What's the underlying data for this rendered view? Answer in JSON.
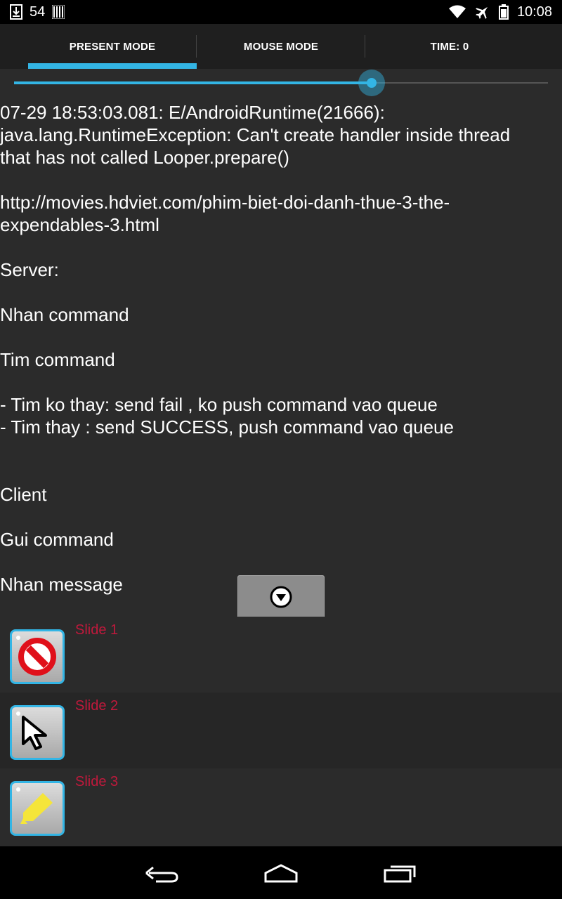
{
  "status_bar": {
    "notification_count": "54",
    "time": "10:08",
    "icons": [
      "download-icon",
      "barcode-icon",
      "wifi-icon",
      "airplane-mode-icon",
      "battery-icon"
    ]
  },
  "tabs": [
    {
      "label": "PRESENT MODE",
      "active": true
    },
    {
      "label": "MOUSE MODE",
      "active": false
    },
    {
      "label": "TIME: 0",
      "active": false
    }
  ],
  "slider": {
    "progress": 0.67
  },
  "notes": {
    "text": "07-29 18:53:03.081: E/AndroidRuntime(21666):\njava.lang.RuntimeException: Can't create handler inside thread\nthat has not called Looper.prepare()\n\nhttp://movies.hdviet.com/phim-biet-doi-danh-thue-3-the-\nexpendables-3.html\n\nServer:\n\nNhan command\n\nTim command\n\n- Tim ko thay: send fail , ko push command vao queue\n- Tim thay : send SUCCESS, push command vao queue\n\n\nClient\n\nGui command\n\nNhan message"
  },
  "dropdown": {
    "icon": "chevron-down-circle-icon"
  },
  "slides": [
    {
      "title": "Slide 1",
      "icon": "prohibited-icon"
    },
    {
      "title": "Slide 2",
      "icon": "cursor-arrow-icon"
    },
    {
      "title": "Slide 3",
      "icon": "highlighter-icon"
    }
  ],
  "navbar": {
    "icons": [
      "back-icon",
      "home-icon",
      "recents-icon"
    ]
  },
  "colors": {
    "accent": "#33b5e5",
    "slide_title": "#c0193c",
    "background": "#2b2b2b"
  }
}
